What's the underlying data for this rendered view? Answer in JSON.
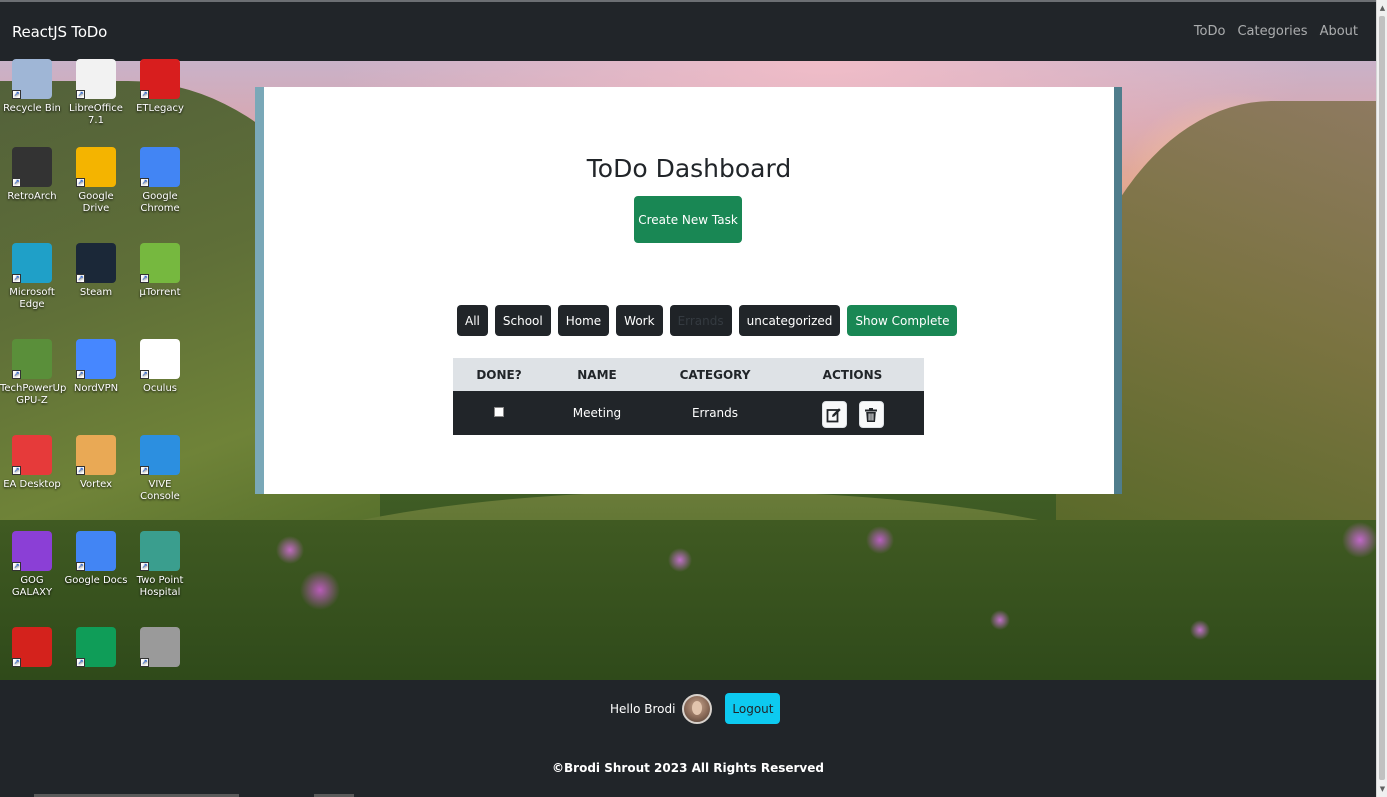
{
  "navbar": {
    "brand": "ReactJS ToDo",
    "links": [
      "ToDo",
      "Categories",
      "About"
    ]
  },
  "desktop": {
    "icons": [
      {
        "label": "Recycle Bin",
        "icon": "recycle-bin-icon",
        "color": "#9fb6d6"
      },
      {
        "label": "LibreOffice 7.1",
        "icon": "libreoffice-icon",
        "color": "#f2f2f2"
      },
      {
        "label": "ETLegacy",
        "icon": "etlegacy-icon",
        "color": "#d81e1e"
      },
      {
        "label": "RetroArch",
        "icon": "retroarch-icon",
        "color": "#333333"
      },
      {
        "label": "Google Drive",
        "icon": "google-drive-icon",
        "color": "#f4b400"
      },
      {
        "label": "Google Chrome",
        "icon": "chrome-icon",
        "color": "#4285f4"
      },
      {
        "label": "Microsoft Edge",
        "icon": "edge-icon",
        "color": "#1fa0c8"
      },
      {
        "label": "Steam",
        "icon": "steam-icon",
        "color": "#1b2838"
      },
      {
        "label": "µTorrent",
        "icon": "utorrent-icon",
        "color": "#76b83f"
      },
      {
        "label": "TechPowerUp GPU-Z",
        "icon": "gpuz-icon",
        "color": "#5a8f3a"
      },
      {
        "label": "NordVPN",
        "icon": "nordvpn-icon",
        "color": "#4687ff"
      },
      {
        "label": "Oculus",
        "icon": "oculus-icon",
        "color": "#ffffff"
      },
      {
        "label": "EA Desktop",
        "icon": "ea-icon",
        "color": "#e63a3a"
      },
      {
        "label": "Vortex",
        "icon": "vortex-icon",
        "color": "#e9a955"
      },
      {
        "label": "VIVE Console",
        "icon": "vive-icon",
        "color": "#2c8fe0"
      },
      {
        "label": "GOG GALAXY",
        "icon": "gog-icon",
        "color": "#8b3fd6"
      },
      {
        "label": "Google Docs",
        "icon": "google-docs-icon",
        "color": "#4285f4"
      },
      {
        "label": "Two Point Hospital",
        "icon": "two-point-hospital-icon",
        "color": "#3a9e8e"
      },
      {
        "label": "",
        "icon": "acrobat-icon",
        "color": "#d4221c"
      },
      {
        "label": "",
        "icon": "google-sheets-icon",
        "color": "#0f9d58"
      },
      {
        "label": "",
        "icon": "app-icon",
        "color": "#9a9a9a"
      }
    ]
  },
  "dashboard": {
    "title": "ToDo Dashboard",
    "create_label": "Create New Task",
    "filters": [
      "All",
      "School",
      "Home",
      "Work",
      "Errands",
      "uncategorized"
    ],
    "active_filter": "Errands",
    "show_complete_label": "Show Complete",
    "table": {
      "headers": [
        "DONE?",
        "NAME",
        "CATEGORY",
        "ACTIONS"
      ],
      "rows": [
        {
          "done": false,
          "name": "Meeting",
          "category": "Errands"
        }
      ]
    }
  },
  "footer": {
    "hello": "Hello Brodi",
    "logout_label": "Logout",
    "copyright": "©Brodi Shrout 2023 All Rights Reserved"
  },
  "colors": {
    "success": "#198754",
    "info": "#0dcaf0",
    "dark": "#212529"
  }
}
